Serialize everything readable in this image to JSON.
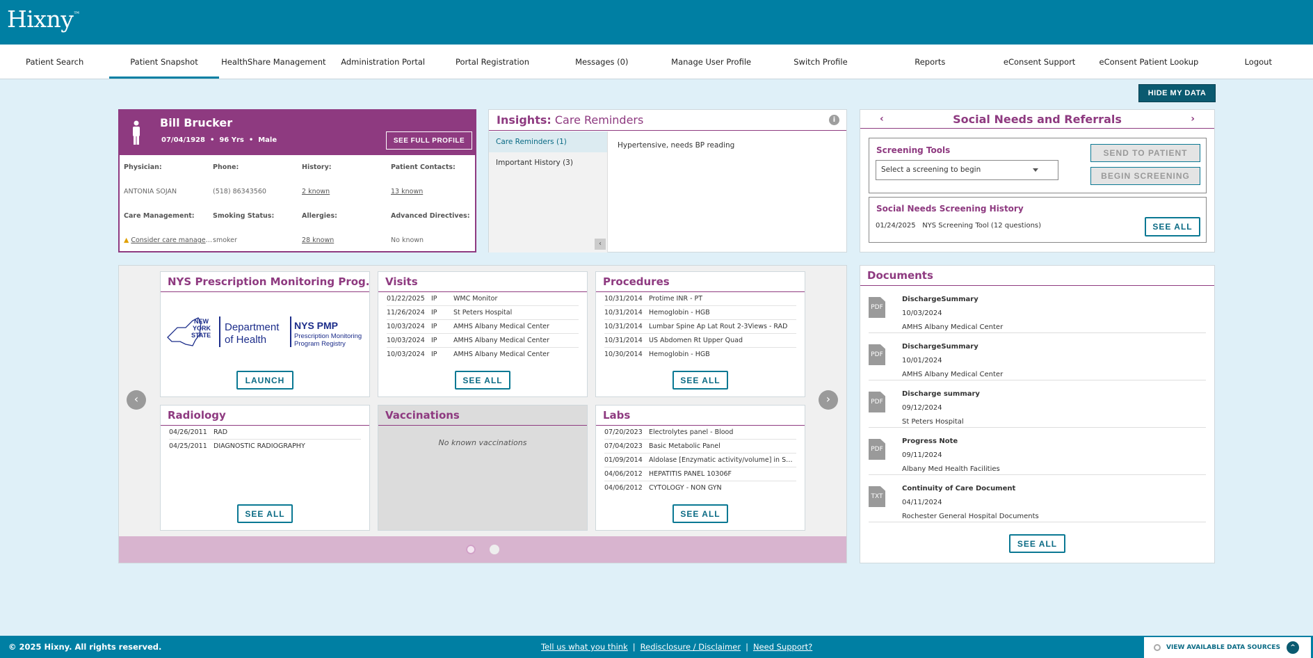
{
  "brand": {
    "logo": "Hixny",
    "tm": "™"
  },
  "nav": [
    {
      "label": "Patient Search"
    },
    {
      "label": "Patient Snapshot"
    },
    {
      "label": "HealthShare Management"
    },
    {
      "label": "Administration Portal"
    },
    {
      "label": "Portal Registration"
    },
    {
      "label": "Messages (0)"
    },
    {
      "label": "Manage User Profile"
    },
    {
      "label": "Switch Profile"
    },
    {
      "label": "Reports"
    },
    {
      "label": "eConsent Support"
    },
    {
      "label": "eConsent Patient Lookup"
    },
    {
      "label": "Logout"
    }
  ],
  "hide_data_label": "HIDE MY DATA",
  "patient": {
    "name": "Bill Brucker",
    "dob": "07/04/1928",
    "age": "96 Yrs",
    "sex": "Male",
    "bullet": "•",
    "full_profile_label": "SEE FULL PROFILE",
    "fields": [
      {
        "label": "Physician:",
        "value": "ANTONIA SOJAN"
      },
      {
        "label": "Phone:",
        "value": "(518) 86343560"
      },
      {
        "label": "History:",
        "value": "2 known"
      },
      {
        "label": "Patient Contacts:",
        "value": "13 known"
      },
      {
        "label": "Care Management:",
        "value": "Consider care management"
      },
      {
        "label": "Smoking Status:",
        "value": "smoker"
      },
      {
        "label": "Allergies:",
        "value": "28 known"
      },
      {
        "label": "Advanced Directives:",
        "value": "No known"
      }
    ]
  },
  "insights": {
    "title": "Insights:",
    "subtitle": "Care Reminders",
    "info": "i",
    "collapse": "‹",
    "tabs": [
      {
        "label": "Care Reminders (1)"
      },
      {
        "label": "Important History (3)"
      }
    ],
    "content": "Hypertensive, needs BP reading"
  },
  "social": {
    "title": "Social Needs and Referrals",
    "prev": "‹",
    "next": "›",
    "screening_tools": "Screening Tools",
    "select_placeholder": "Select a screening to begin",
    "send_label": "SEND TO PATIENT",
    "begin_label": "BEGIN SCREENING",
    "history_title": "Social Needs Screening History",
    "history_date": "01/24/2025",
    "history_item": "NYS Screening Tool (12 questions)",
    "see_all": "SEE ALL"
  },
  "carousel": {
    "prev": "‹",
    "next": "›"
  },
  "pmp": {
    "title": "NYS Prescription Monitoring Prog...",
    "launch": "LAUNCH",
    "logo": {
      "ny1": "NEW",
      "ny2": "YORK",
      "ny3": "STATE",
      "doh1": "Department",
      "doh2": "of Health",
      "pmp1": "NYS PMP",
      "pmp2": "Prescription Monitoring",
      "pmp3": "Program Registry"
    }
  },
  "visits": {
    "title": "Visits",
    "see_all": "SEE ALL",
    "rows": [
      {
        "date": "01/22/2025",
        "type": "IP",
        "desc": "WMC Monitor"
      },
      {
        "date": "11/26/2024",
        "type": "IP",
        "desc": "St Peters Hospital"
      },
      {
        "date": "10/03/2024",
        "type": "IP",
        "desc": "AMHS Albany Medical Center"
      },
      {
        "date": "10/03/2024",
        "type": "IP",
        "desc": "AMHS Albany Medical Center"
      },
      {
        "date": "10/03/2024",
        "type": "IP",
        "desc": "AMHS Albany Medical Center"
      }
    ]
  },
  "procedures": {
    "title": "Procedures",
    "see_all": "SEE ALL",
    "rows": [
      {
        "date": "10/31/2014",
        "desc": "Protime INR - PT"
      },
      {
        "date": "10/31/2014",
        "desc": "Hemoglobin - HGB"
      },
      {
        "date": "10/31/2014",
        "desc": "Lumbar Spine Ap Lat Rout 2-3Views - RAD"
      },
      {
        "date": "10/31/2014",
        "desc": "US Abdomen Rt Upper Quad"
      },
      {
        "date": "10/30/2014",
        "desc": "Hemoglobin - HGB"
      }
    ]
  },
  "radiology": {
    "title": "Radiology",
    "see_all": "SEE ALL",
    "rows": [
      {
        "date": "04/26/2011",
        "desc": "RAD"
      },
      {
        "date": "04/25/2011",
        "desc": "DIAGNOSTIC RADIOGRAPHY"
      }
    ]
  },
  "vaccinations": {
    "title": "Vaccinations",
    "empty": "No known vaccinations"
  },
  "labs": {
    "title": "Labs",
    "see_all": "SEE ALL",
    "rows": [
      {
        "date": "07/20/2023",
        "desc": "Electrolytes panel - Blood"
      },
      {
        "date": "07/04/2023",
        "desc": "Basic Metabolic Panel"
      },
      {
        "date": "01/09/2014",
        "desc": "Aldolase [Enzymatic activity/volume] in Serum or Plasma"
      },
      {
        "date": "04/06/2012",
        "desc": "HEPATITIS PANEL 10306F"
      },
      {
        "date": "04/06/2012",
        "desc": "CYTOLOGY - NON GYN"
      }
    ]
  },
  "documents": {
    "title": "Documents",
    "see_all": "SEE ALL",
    "items": [
      {
        "icon": "PDF",
        "name": "DischargeSummary",
        "date": "10/03/2024",
        "source": "AMHS Albany Medical Center"
      },
      {
        "icon": "PDF",
        "name": "DischargeSummary",
        "date": "10/01/2024",
        "source": "AMHS Albany Medical Center"
      },
      {
        "icon": "PDF",
        "name": "Discharge summary",
        "date": "09/12/2024",
        "source": "St Peters Hospital"
      },
      {
        "icon": "PDF",
        "name": "Progress Note",
        "date": "09/11/2024",
        "source": "Albany Med Health Facilities"
      },
      {
        "icon": "TXT",
        "name": "Continuity of Care Document",
        "date": "04/11/2024",
        "source": "Rochester General Hospital Documents"
      }
    ]
  },
  "footer": {
    "copyright": "© 2025 Hixny. All rights reserved.",
    "link1": "Tell us what you think",
    "link2": "Redisclosure / Disclaimer",
    "link3": "Need Support?",
    "sep": "|",
    "sources": "VIEW AVAILABLE DATA SOURCES",
    "up": "^"
  },
  "colors": {
    "brand": "#007fa3",
    "accent": "#8e3a80",
    "background": "#dff0f8"
  }
}
